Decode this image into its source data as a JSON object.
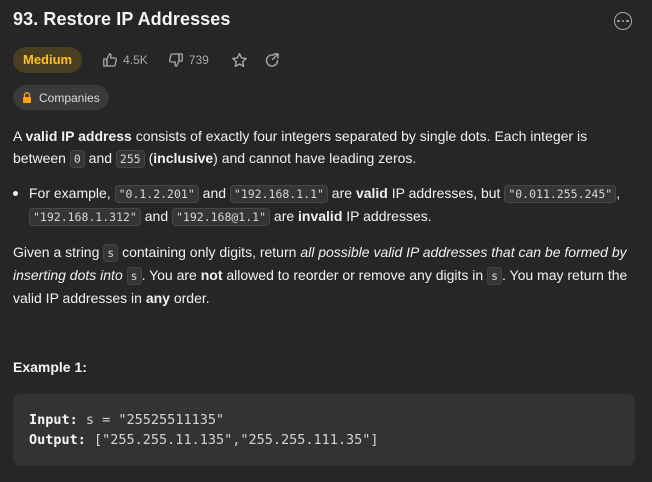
{
  "problem": {
    "title": "93. Restore IP Addresses",
    "difficulty": "Medium",
    "likes": "4.5K",
    "dislikes": "739",
    "companies_label": "Companies"
  },
  "description": {
    "p1": {
      "t1": "A ",
      "b1": "valid IP address",
      "t2": " consists of exactly four integers separated by single dots. Each integer is between ",
      "c1": "0",
      "t3": " and ",
      "c2": "255",
      "t4": " (",
      "b2": "inclusive",
      "t5": ") and cannot have leading zeros."
    },
    "bullet": {
      "t1": "For example, ",
      "c1": "\"0.1.2.201\"",
      "t2": " and ",
      "c2": "\"192.168.1.1\"",
      "t3": " are ",
      "b1": "valid",
      "t4": " IP addresses, but ",
      "c3": "\"0.011.255.245\"",
      "t5": ", ",
      "c4": "\"192.168.1.312\"",
      "t6": " and ",
      "c5": "\"192.168@1.1\"",
      "t7": " are ",
      "b2": "invalid",
      "t8": " IP addresses."
    },
    "p3": {
      "t1": "Given a string ",
      "c1": "s",
      "t2": " containing only digits, return ",
      "i1": "all possible valid IP addresses that can be formed by inserting dots into ",
      "c2": "s",
      "t3": ". You are ",
      "b1": "not",
      "t4": " allowed to reorder or remove any digits in ",
      "c3": "s",
      "t5": ". You may return the valid IP addresses in ",
      "b2": "any",
      "t6": " order."
    }
  },
  "example1": {
    "title": "Example 1:",
    "input_label": "Input:",
    "input_value": " s = \"25525511135\"",
    "output_label": "Output:",
    "output_value": " [\"255.255.11.135\",\"255.255.111.35\"]"
  },
  "colors": {
    "background": "#262626",
    "medium": "#ffc01e",
    "medium_bg": "#4a3e21",
    "code_bg": "#353535"
  },
  "icons": [
    "more-icon",
    "thumbs-up-icon",
    "thumbs-down-icon",
    "star-icon",
    "share-icon",
    "lock-icon"
  ]
}
